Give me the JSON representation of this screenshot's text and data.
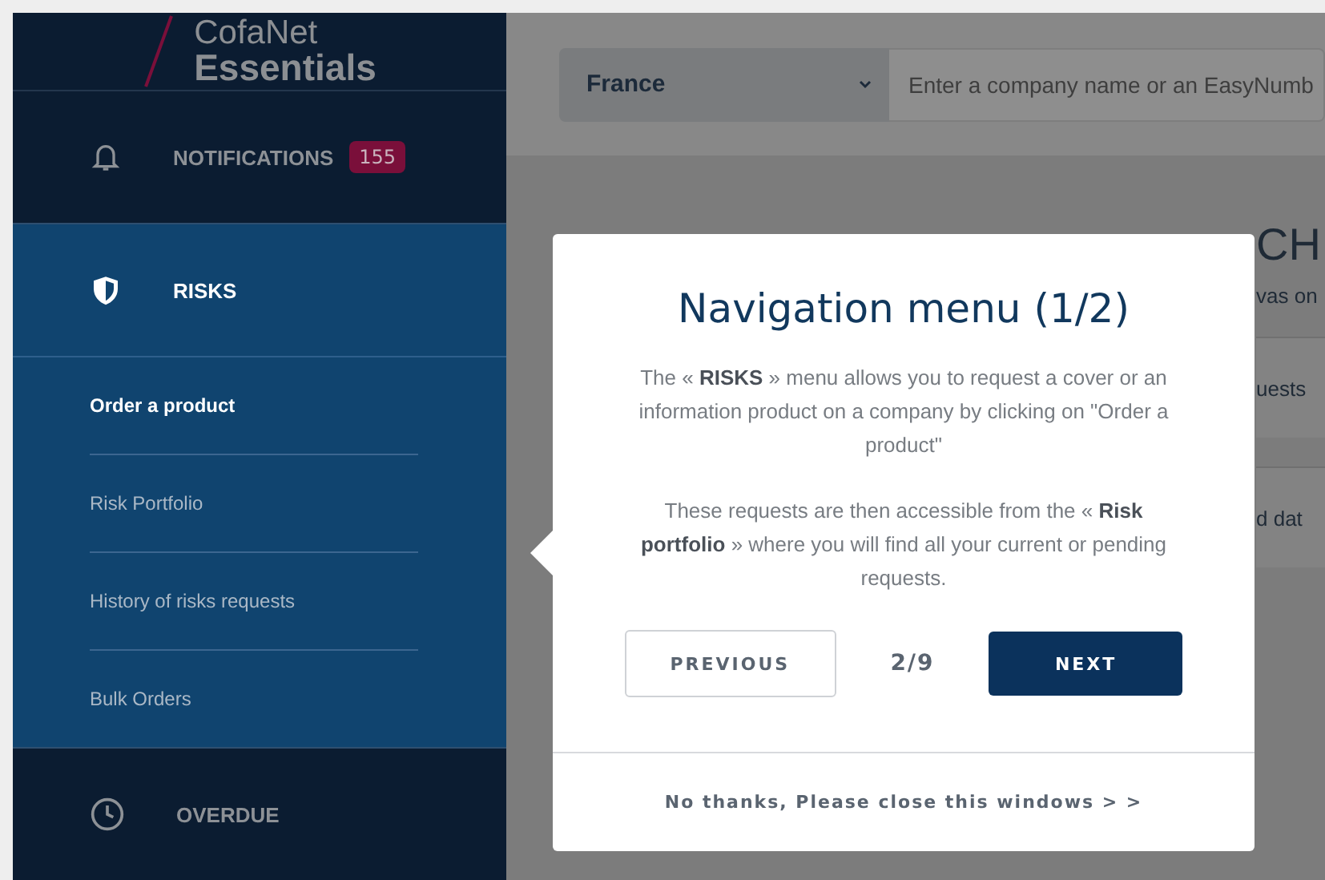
{
  "logo": {
    "line1": "CofaNet",
    "line2": "Essentials"
  },
  "nav": [
    {
      "label": "NOTIFICATIONS",
      "badge": "155",
      "selected": false
    },
    {
      "label": "RISKS",
      "selected": true,
      "expanded": true,
      "children": [
        {
          "label": "Order a product",
          "selected": true
        },
        {
          "label": "Risk Portfolio",
          "selected": false
        },
        {
          "label": "History of risks requests",
          "selected": false
        },
        {
          "label": "Bulk Orders",
          "selected": false
        }
      ]
    },
    {
      "label": "OVERDUE",
      "selected": false
    }
  ],
  "search": {
    "country": "France",
    "placeholder": "Enter a company name or an EasyNumb"
  },
  "background": {
    "heading": "CH",
    "texts": [
      "vas on",
      "uests",
      "d dat"
    ]
  },
  "modal": {
    "title": "Navigation menu (1/2)",
    "paragraphs": [
      "The « **RISKS** » menu allows you to request a cover or an information product on a company by clicking on \"Order a product\"",
      "These requests are then accessible from the « **Risk portfolio** » where you will find all your current or pending requests."
    ],
    "previous": "PREVIOUS",
    "counter": "2/9",
    "next": "NEXT",
    "close_link": "No thanks, Please close this windows > >"
  }
}
